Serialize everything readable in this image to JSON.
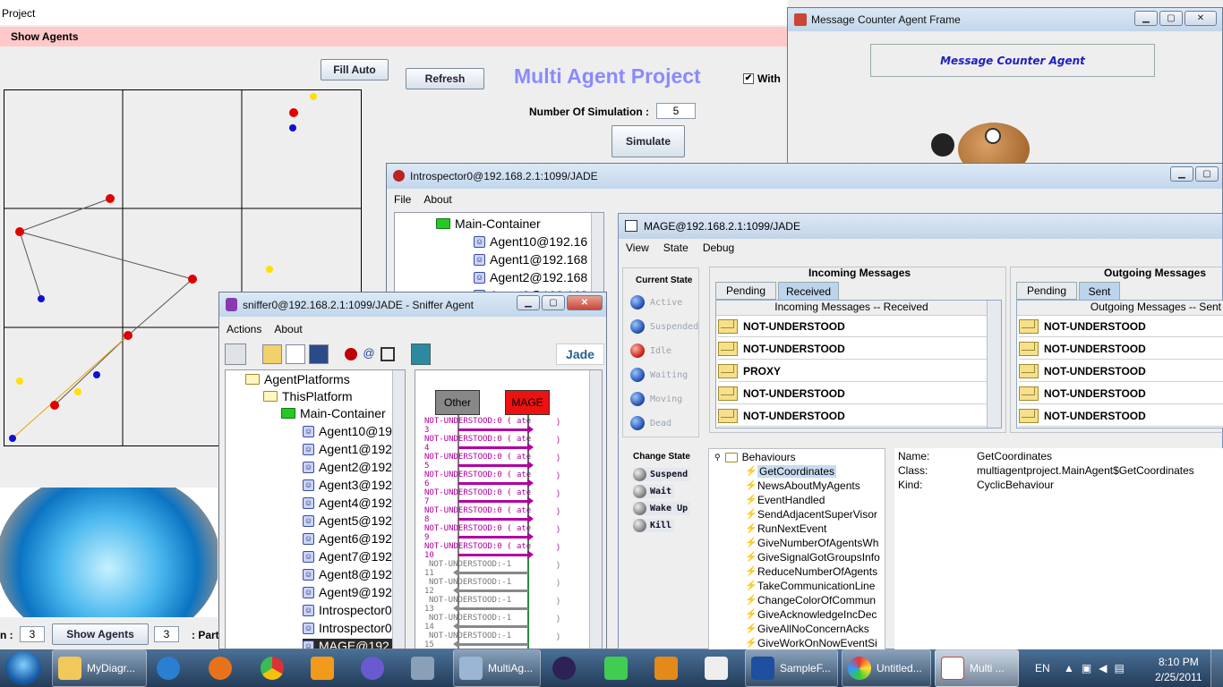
{
  "project_window": {
    "title": "Project",
    "menu": "Show Agents",
    "fill_auto": "Fill Auto",
    "refresh": "Refresh",
    "heading": "Multi Agent Project",
    "with_label": "With",
    "num_sim_label": "Number Of Simulation :",
    "num_sim_value": "5",
    "simulate": "Simulate",
    "bottom_prefix": "n :",
    "bottom_val1": "3",
    "show_agents_btn": "Show Agents",
    "bottom_val2": "3",
    "bottom_suffix": ": Part"
  },
  "counter_window": {
    "title": "Message Counter Agent Frame",
    "label": "Message Counter Agent"
  },
  "introspector": {
    "title": "Introspector0@192.168.2.1:1099/JADE",
    "menu": [
      "File",
      "About"
    ],
    "tree": [
      "Main-Container",
      "Agent10@192.16",
      "Agent1@192.168",
      "Agent2@192.168",
      "Agent3@192.168"
    ]
  },
  "mage": {
    "title": "MAGE@192.168.2.1:1099/JADE",
    "menu": [
      "View",
      "State",
      "Debug"
    ],
    "current_state_label": "Current State",
    "states": [
      "Active",
      "Suspended",
      "Idle",
      "Waiting",
      "Moving",
      "Dead"
    ],
    "change_state_label": "Change State",
    "change_buttons": [
      "Suspend",
      "Wait",
      "Wake Up",
      "Kill"
    ],
    "incoming_title": "Incoming Messages",
    "incoming_tabs": [
      "Pending",
      "Received"
    ],
    "incoming_header": "Incoming Messages --  Received",
    "incoming_msgs": [
      "NOT-UNDERSTOOD",
      "NOT-UNDERSTOOD",
      "PROXY",
      "NOT-UNDERSTOOD",
      "NOT-UNDERSTOOD"
    ],
    "outgoing_title": "Outgoing Messages",
    "outgoing_tabs": [
      "Pending",
      "Sent"
    ],
    "outgoing_header": "Outgoing Messages -- Sent",
    "outgoing_msgs": [
      "NOT-UNDERSTOOD",
      "NOT-UNDERSTOOD",
      "NOT-UNDERSTOOD",
      "NOT-UNDERSTOOD",
      "NOT-UNDERSTOOD"
    ],
    "behaviours_root": "Behaviours",
    "behaviours": [
      "GetCoordinates",
      "NewsAboutMyAgents",
      "EventHandled",
      "SendAdjacentSuperVisor",
      "RunNextEvent",
      "GiveNumberOfAgentsWh",
      "GiveSignalGotGroupsInfo",
      "ReduceNumberOfAgents",
      "TakeCommunicationLine",
      "ChangeColorOfCommun",
      "GiveAcknowledgeIncDec",
      "GiveAllNoConcernAcks",
      "GiveWorkOnNowEventSi"
    ],
    "details": {
      "name_label": "Name:",
      "name": "GetCoordinates",
      "class_label": "Class:",
      "class": "multiagentproject.MainAgent$GetCoordinates",
      "kind_label": "Kind:",
      "kind": "CyclicBehaviour"
    }
  },
  "sniffer": {
    "title": "sniffer0@192.168.2.1:1099/JADE - Sniffer Agent",
    "menu": [
      "Actions",
      "About"
    ],
    "logo": "Jade",
    "tree": [
      "AgentPlatforms",
      "ThisPlatform",
      "Main-Container",
      "Agent10@19",
      "Agent1@192",
      "Agent2@192",
      "Agent3@192",
      "Agent4@192",
      "Agent5@192",
      "Agent6@192",
      "Agent7@192",
      "Agent8@192",
      "Agent9@192",
      "Introspector0",
      "Introspector0",
      "MAGE@192"
    ],
    "col_other": "Other",
    "col_mage": "MAGE",
    "rows": [
      {
        "label": "NOT-UNDERSTOOD:0 ( ate",
        "n": "3"
      },
      {
        "label": "NOT-UNDERSTOOD:0 ( ate",
        "n": "4"
      },
      {
        "label": "NOT-UNDERSTOOD:0 ( ate",
        "n": "5"
      },
      {
        "label": "NOT-UNDERSTOOD:0 ( ate",
        "n": "6"
      },
      {
        "label": "NOT-UNDERSTOOD:0 ( ate",
        "n": "7"
      },
      {
        "label": "NOT-UNDERSTOOD:0 ( ate",
        "n": "8"
      },
      {
        "label": "NOT-UNDERSTOOD:0 ( ate",
        "n": "9"
      },
      {
        "label": "NOT-UNDERSTOOD:0 ( ate",
        "n": "10"
      },
      {
        "label": "NOT-UNDERSTOOD:-1",
        "n": "11"
      },
      {
        "label": "NOT-UNDERSTOOD:-1",
        "n": "12"
      },
      {
        "label": "NOT-UNDERSTOOD:-1",
        "n": "13"
      },
      {
        "label": "NOT-UNDERSTOOD:-1",
        "n": "14"
      },
      {
        "label": "NOT-UNDERSTOOD:-1",
        "n": "15"
      }
    ]
  },
  "taskbar": {
    "items": [
      "MyDiagr...",
      "MultiAg...",
      "SampleF...",
      "Untitled...",
      "Multi ..."
    ],
    "lang": "EN",
    "time": "8:10 PM",
    "date": "2/25/2011"
  },
  "colors": {
    "accent": "#8a8aff",
    "red": "#e00000",
    "magenta": "#b000a0"
  }
}
